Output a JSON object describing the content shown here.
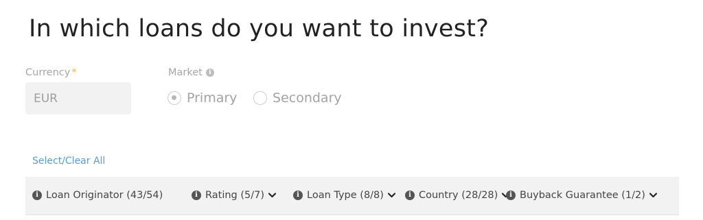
{
  "title": "In which loans do you want to invest?",
  "currency": {
    "label": "Currency",
    "required_mark": "*",
    "value": "EUR"
  },
  "market": {
    "label": "Market",
    "options": [
      {
        "label": "Primary",
        "selected": true
      },
      {
        "label": "Secondary",
        "selected": false
      }
    ]
  },
  "select_clear_label": "Select/Clear All",
  "filters": [
    {
      "label": "Loan Originator (43/54)",
      "has_dropdown": false
    },
    {
      "label": "Rating (5/7)",
      "has_dropdown": true
    },
    {
      "label": "Loan Type (8/8)",
      "has_dropdown": true
    },
    {
      "label": "Country (28/28)",
      "has_dropdown": true
    },
    {
      "label": "Buyback Guarantee (1/2)",
      "has_dropdown": true
    }
  ],
  "icons": {
    "info": "info-icon",
    "chevron": "chevron-down-icon"
  },
  "colors": {
    "required": "#f5b72f",
    "link": "#5b9bd5",
    "filter_bg": "#f2f2f2"
  }
}
